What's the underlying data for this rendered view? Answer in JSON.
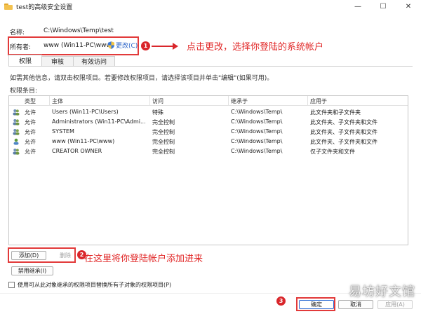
{
  "window": {
    "title": "test的高级安全设置",
    "minimize_glyph": "—",
    "maximize_glyph": "☐",
    "close_glyph": "✕"
  },
  "name_field": {
    "label": "名称:",
    "value": "C:\\Windows\\Temp\\test"
  },
  "owner_field": {
    "label": "所有者:",
    "value": "www (Win11-PC\\www)",
    "change_link": "更改(C)"
  },
  "annotations": {
    "step1_badge": "1",
    "step1_text": "点击更改，选择你登陆的系统帐户",
    "step2_badge": "2",
    "step2_text": "在这里将你登陆帐户添加进来",
    "step3_badge": "3"
  },
  "tabs": [
    {
      "label": "权限",
      "active": true
    },
    {
      "label": "审核",
      "active": false
    },
    {
      "label": "有效访问",
      "active": false
    }
  ],
  "info_text": "如需其他信息，请双击权限项目。若要修改权限项目，请选择该项目并单击\"编辑\"(如果可用)。",
  "entries_label": "权限条目:",
  "table": {
    "headers": [
      "类型",
      "主体",
      "访问",
      "继承于",
      "应用于"
    ],
    "rows": [
      {
        "type": "允许",
        "principal": "Users (Win11-PC\\Users)",
        "access": "特殊",
        "inherited": "C:\\Windows\\Temp\\",
        "applies": "此文件夹和子文件夹",
        "icon": "users-group-icon"
      },
      {
        "type": "允许",
        "principal": "Administrators (Win11-PC\\Admi...",
        "access": "完全控制",
        "inherited": "C:\\Windows\\Temp\\",
        "applies": "此文件夹、子文件夹和文件",
        "icon": "users-group-icon"
      },
      {
        "type": "允许",
        "principal": "SYSTEM",
        "access": "完全控制",
        "inherited": "C:\\Windows\\Temp\\",
        "applies": "此文件夹、子文件夹和文件",
        "icon": "users-group-icon"
      },
      {
        "type": "允许",
        "principal": "www (Win11-PC\\www)",
        "access": "完全控制",
        "inherited": "C:\\Windows\\Temp\\",
        "applies": "此文件夹、子文件夹和文件",
        "icon": "single-user-icon"
      },
      {
        "type": "允许",
        "principal": "CREATOR OWNER",
        "access": "完全控制",
        "inherited": "C:\\Windows\\Temp\\",
        "applies": "仅子文件夹和文件",
        "icon": "users-group-icon"
      }
    ]
  },
  "buttons": {
    "add": "添加(D)",
    "remove": "删除",
    "disable_inheritance": "禁用继承(I)",
    "ok": "确定",
    "cancel": "取消",
    "apply": "应用(A)"
  },
  "replace_checkbox": {
    "label": "使用可从此对象继承的权限项目替换所有子对象的权限项目(P)",
    "checked": false
  },
  "watermark": "易坊好文馆",
  "colors": {
    "annotation_red": "#d9262b",
    "link_blue": "#2a63c8",
    "folder_yellow": "#f3c24f"
  }
}
